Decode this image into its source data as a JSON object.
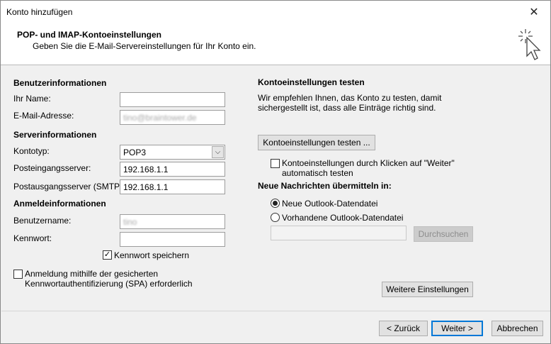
{
  "window": {
    "title": "Konto hinzufügen",
    "close_glyph": "✕"
  },
  "header": {
    "title": "POP- und IMAP-Kontoeinstellungen",
    "subtitle": "Geben Sie die E-Mail-Servereinstellungen für Ihr Konto ein."
  },
  "left": {
    "user_info_heading": "Benutzerinformationen",
    "name_label": "Ihr Name:",
    "name_value": "",
    "email_label": "E-Mail-Adresse:",
    "email_value": "tino@braintower.de",
    "server_info_heading": "Serverinformationen",
    "account_type_label": "Kontotyp:",
    "account_type_value": "POP3",
    "incoming_label": "Posteingangsserver:",
    "incoming_value": "192.168.1.1",
    "outgoing_label": "Postausgangsserver (SMTP):",
    "outgoing_value": "192.168.1.1",
    "login_info_heading": "Anmeldeinformationen",
    "username_label": "Benutzername:",
    "username_value": "tino",
    "password_label": "Kennwort:",
    "password_value": "",
    "remember_password_label": "Kennwort speichern",
    "remember_password_checked": true,
    "spa_label_line1": "Anmeldung mithilfe der gesicherten",
    "spa_label_line2": "Kennwortauthentifizierung (SPA) erforderlich",
    "spa_checked": false
  },
  "right": {
    "test_heading": "Kontoeinstellungen testen",
    "test_desc_line1": "Wir empfehlen Ihnen, das Konto zu testen, damit",
    "test_desc_line2": "sichergestellt ist, dass alle Einträge richtig sind.",
    "test_button": "Kontoeinstellungen testen ...",
    "auto_test_line1": "Kontoeinstellungen durch Klicken auf \"Weiter\"",
    "auto_test_line2": "automatisch testen",
    "auto_test_checked": false,
    "deliver_heading": "Neue Nachrichten übermitteln in:",
    "new_file_label": "Neue Outlook-Datendatei",
    "existing_file_label": "Vorhandene Outlook-Datendatei",
    "selected_option": "new",
    "browse_button": "Durchsuchen",
    "more_settings_button": "Weitere Einstellungen"
  },
  "footer": {
    "back_button": "< Zurück",
    "next_button": "Weiter >",
    "cancel_button": "Abbrechen"
  },
  "colors": {
    "focus_border": "#0078d7",
    "panel_bg": "#f0f0f0"
  },
  "icons": {
    "wizard": "cursor-sparkle-icon",
    "checkbox_check": "✓",
    "dropdown": "chevron-down-icon"
  }
}
